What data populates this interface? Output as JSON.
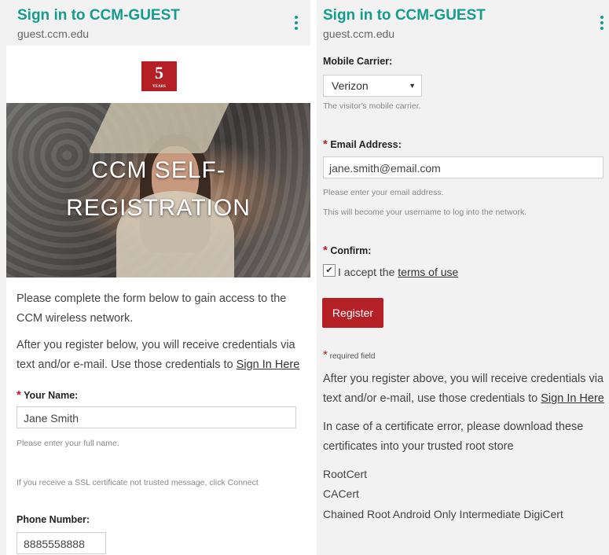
{
  "left": {
    "appbar": {
      "title": "Sign in to CCM-GUEST",
      "url": "guest.ccm.edu"
    },
    "logo": {
      "text": "5",
      "caption": "YEARS"
    },
    "hero": {
      "line1": "CCM SELF-",
      "line2": "REGISTRATION"
    },
    "intro": "Please complete the form below to gain access to the CCM wireless network.",
    "after_text": "After you register below, you will receive credentials via text and/or e-mail. Use those credentials to ",
    "sign_in_link": "Sign In Here",
    "name_label": "Your Name:",
    "name_value": "Jane Smith",
    "name_help": "Please enter your full name.",
    "ssl_help": "If you receive a SSL certificate not trusted message, click Connect",
    "phone_label": "Phone Number:",
    "phone_value": "8885558888"
  },
  "right": {
    "appbar": {
      "title": "Sign in to CCM-GUEST",
      "url": "guest.ccm.edu"
    },
    "carrier_label": "Mobile Carrier:",
    "carrier_value": "Verizon",
    "carrier_help": "The visitor's mobile carrier.",
    "email_label": "Email Address:",
    "email_value": "jane.smith@email.com",
    "email_help1": "Please enter your email address.",
    "email_help2": "This will become your username to log into the network.",
    "confirm_label": "Confirm:",
    "accept_text": "I accept the ",
    "terms_link": "terms of use",
    "register_label": "Register",
    "required_note": "required field",
    "after_text": "After you register above, you will receive credentials via text and/or e-mail, use those credentials to ",
    "sign_in_link": "Sign In Here",
    "cert_text": "In case of a certificate error, please download these certificates into your trusted root store",
    "cert_links": [
      "RootCert",
      "CACert",
      "Chained Root Android Only Intermediate DigiCert"
    ]
  },
  "required_marker": "*",
  "colors": {
    "accent": "#149c8c",
    "brand": "#b42025"
  }
}
